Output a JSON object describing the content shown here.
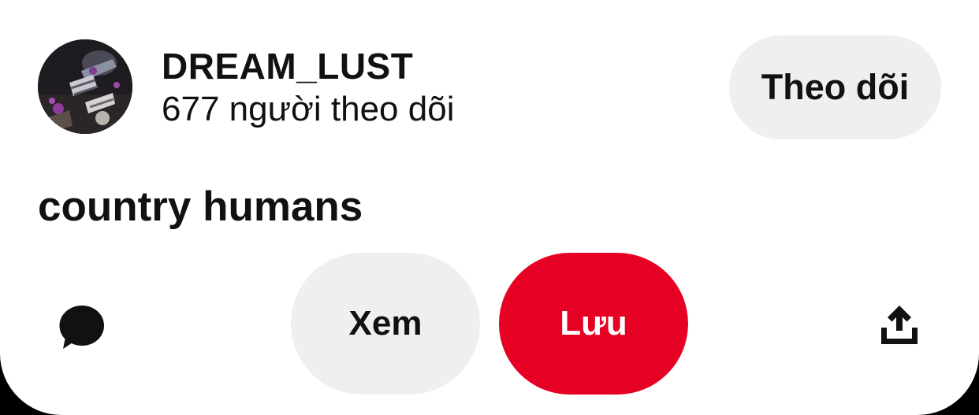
{
  "creator": {
    "name": "DREAM_LUST",
    "followers_text": "677 người theo dõi",
    "follow_label": "Theo dõi"
  },
  "pin": {
    "title": "country humans"
  },
  "actions": {
    "view_label": "Xem",
    "save_label": "Lưu",
    "comment_icon": "comment-bubble-icon",
    "share_icon": "share-upload-icon"
  },
  "colors": {
    "primary": "#e60023",
    "secondary_button": "#efefef",
    "text": "#111111",
    "background": "#ffffff"
  }
}
